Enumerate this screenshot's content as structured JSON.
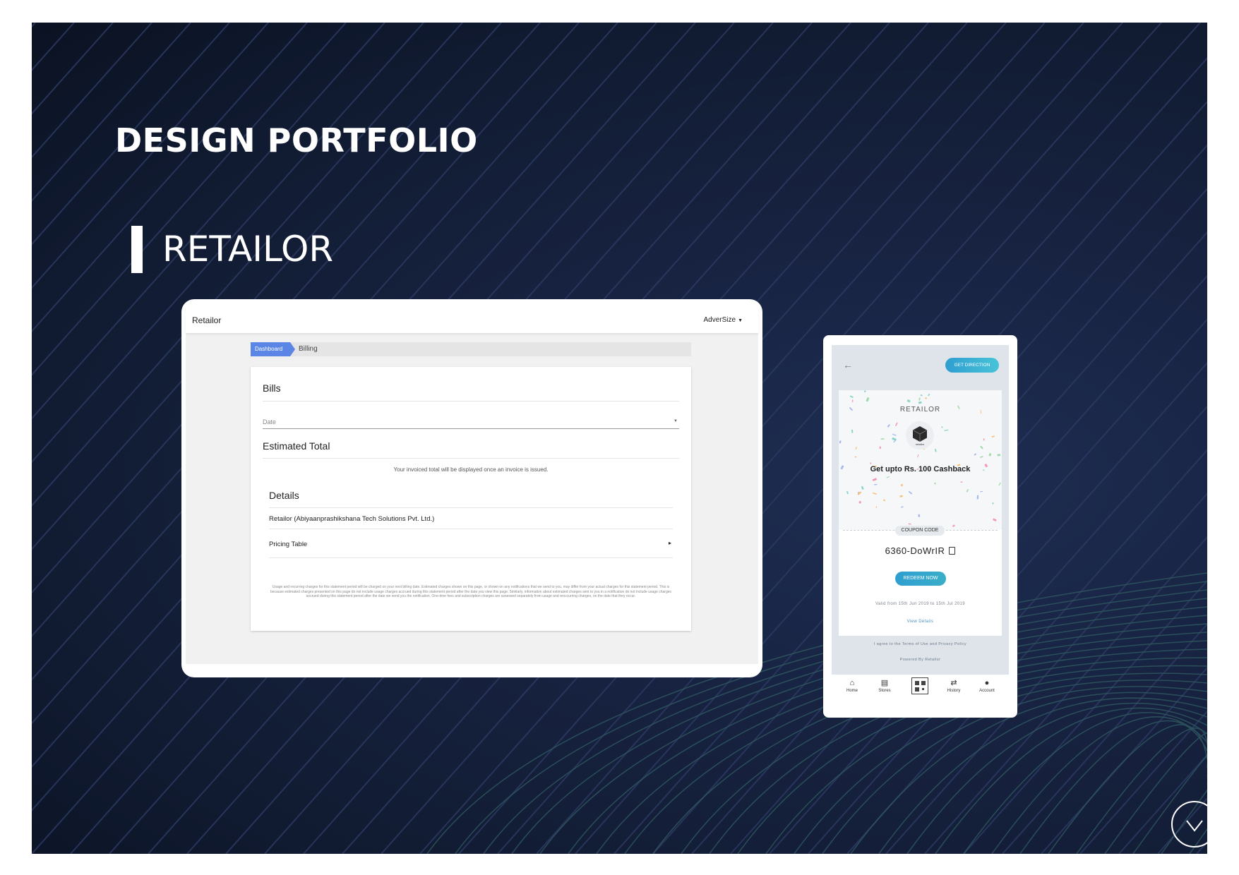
{
  "slide": {
    "title": "DESIGN PORTFOLIO",
    "section": "RETAILOR"
  },
  "desktop": {
    "brand": "Retailor",
    "user_menu": "AdverSize",
    "breadcrumb": {
      "active": "Dashboard",
      "current": "Billing"
    },
    "bills_title": "Bills",
    "date_label": "Date",
    "estimated_title": "Estimated Total",
    "estimated_note": "Your invoiced total will be displayed once an invoice is issued.",
    "details_title": "Details",
    "company": "Retailor (Abiyaanprashikshana Tech Solutions Pvt. Ltd.)",
    "pricing_table": "Pricing Table",
    "disclaimer": "Usage and recurring charges for this statement period will be charged on your next billing date. Estimated charges shown on this page, or shown on any notifications that we send to you, may differ from your actual charges for this statement period. This is because estimated charges presented on this page do not include usage charges accrued during this statement period after the date you view this page. Similarly, information about estimated charges sent to you in a notification do not include usage charges accrued during this statement period after the date we send you the notification. One-time fees and subscription charges are assessed separately from usage and reoccurring charges, on the date that they occur."
  },
  "mobile": {
    "back_icon": "arrow-left-icon",
    "get_direction": "GET DIRECTION",
    "brand": "RETAILOR",
    "logo_text": "retailor",
    "offer": "Get upto Rs. 100 Cashback",
    "coupon_label": "COUPON CODE",
    "coupon_code": "6360-DoWrIR",
    "redeem": "REDEEM NOW",
    "valid": "Valid from 15th Jun 2019 to 15th Jul 2019",
    "view_details": "View Details",
    "terms": "I agree to the Terms of Use and Privacy Policy",
    "powered": "Powered By Retailor",
    "nav": {
      "home": "Home",
      "stores": "Stores",
      "history": "History",
      "account": "Account"
    }
  },
  "colors": {
    "accent_blue": "#5b86e5",
    "teal_button": "#2f9ed0",
    "background_navy": "#131d36"
  }
}
